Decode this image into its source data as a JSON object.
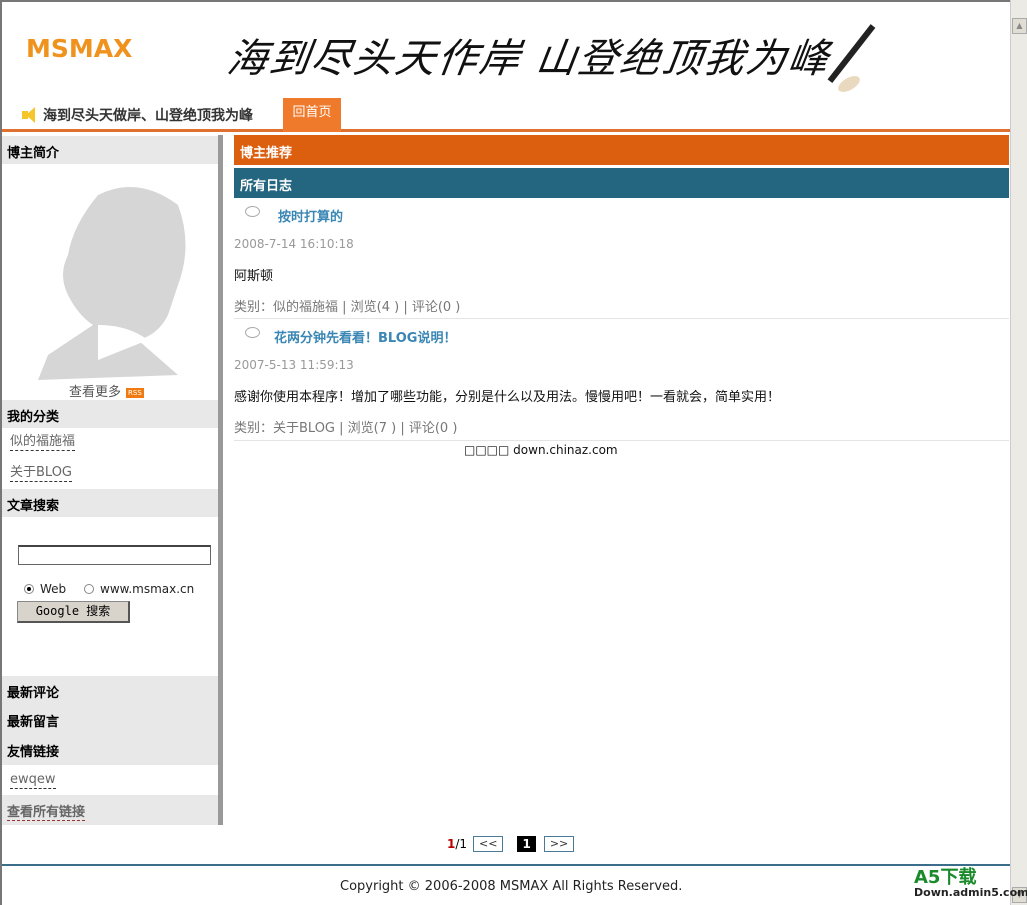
{
  "header": {
    "logo": "MSMAX",
    "calligraphy": "海到尽头天作岸 山登绝顶我为峰"
  },
  "nav": {
    "slogan": "海到尽头天做岸、山登绝顶我为峰",
    "home": "回首页"
  },
  "sidebar": {
    "profile_title": "博主简介",
    "view_more": "查看更多",
    "rss": "RSS",
    "categories_title": "我的分类",
    "categories": [
      "似的福施福",
      "关于BLOG"
    ],
    "search_title": "文章搜索",
    "search_value": "",
    "radio_web": "Web",
    "radio_site": "www.msmax.cn",
    "search_button": "Google 搜索",
    "latest_comments": "最新评论",
    "latest_messages": "最新留言",
    "links_title": "友情链接",
    "links": [
      "ewqew"
    ],
    "all_links": "查看所有链接"
  },
  "main": {
    "recommend_title": "博主推荐",
    "all_posts_title": "所有日志",
    "posts": [
      {
        "title": "按时打算的",
        "date": "2008-7-14 16:10:18",
        "body": "阿斯顿",
        "meta": "类别：似的福施福  | 浏览(4 ) | 评论(0 )"
      },
      {
        "title": "花两分钟先看看！BLOG说明！",
        "date": "2007-5-13 11:59:13",
        "body": "感谢你使用本程序！增加了哪些功能，分别是什么以及用法。慢慢用吧！一看就会，简单实用！",
        "meta": "类别：关于BLOG | 浏览(7 ) | 评论(0 )"
      }
    ],
    "source_note": "□□□□ down.chinaz.com"
  },
  "pager": {
    "current": "1",
    "total": "/1",
    "prev": "<<",
    "page": "1",
    "next": ">>"
  },
  "footer": {
    "copyright": "Copyright © 2006-2008 MSMAX All Rights Reserved.",
    "badge": "A5下载",
    "badge_sub": "Down.admin5.com"
  }
}
